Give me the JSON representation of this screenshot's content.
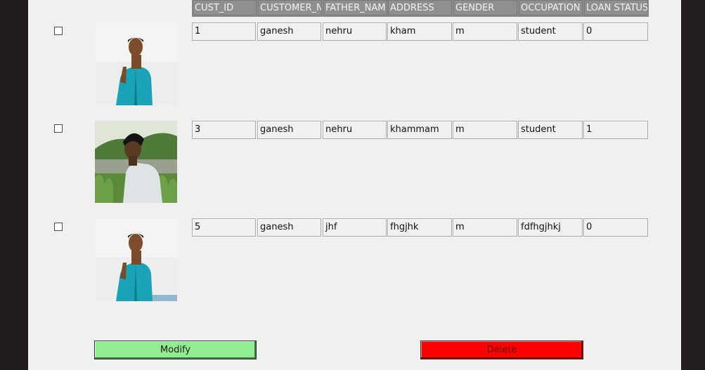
{
  "columns": [
    "CUST_ID",
    "CUSTOMER_N",
    "FATHER_NAM",
    "ADDRESS",
    "GENDER",
    "OCCUPATION",
    "LOAN STATUS"
  ],
  "rows": [
    {
      "selected": false,
      "photo": "person-raising-finger-photo",
      "cells": [
        "1",
        "ganesh",
        "nehru",
        "kham",
        "m",
        "student",
        "0"
      ]
    },
    {
      "selected": false,
      "photo": "person-looking-down-photo",
      "cells": [
        "3",
        "ganesh",
        "nehru",
        "khammam",
        "m",
        "student",
        "1"
      ]
    },
    {
      "selected": false,
      "photo": "person-raising-finger-photo",
      "cells": [
        "5",
        "ganesh",
        "jhf",
        "fhgjhk",
        "m",
        "fdfhgjhkj",
        "0"
      ]
    }
  ],
  "buttons": {
    "modify": "Modify",
    "delete": "Delete"
  },
  "colors": {
    "modify_bg": "#90ee90",
    "delete_bg": "#ff0000",
    "header_bg": "#8f8f8f",
    "panel_bg": "#f0f0f0"
  }
}
